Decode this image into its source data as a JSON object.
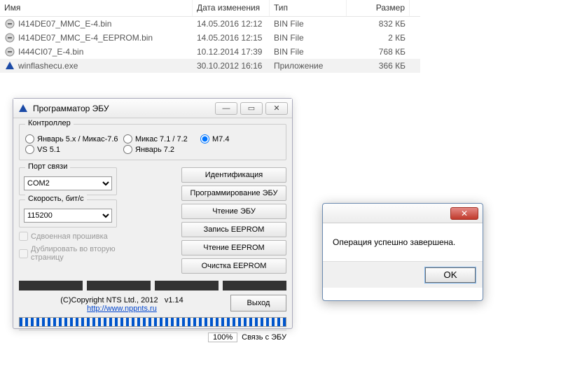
{
  "filelist": {
    "headers": {
      "name": "Имя",
      "date": "Дата изменения",
      "type": "Тип",
      "size": "Размер"
    },
    "rows": [
      {
        "icon": "binfile",
        "name": "I414DE07_MMC_E-4.bin",
        "date": "14.05.2016 12:12",
        "type": "BIN File",
        "size": "832 КБ",
        "selected": false
      },
      {
        "icon": "binfile",
        "name": "I414DE07_MMC_E-4_EEPROM.bin",
        "date": "14.05.2016 12:15",
        "type": "BIN File",
        "size": "2 КБ",
        "selected": false
      },
      {
        "icon": "binfile",
        "name": "I444CI07_E-4.bin",
        "date": "10.12.2014 17:39",
        "type": "BIN File",
        "size": "768 КБ",
        "selected": false
      },
      {
        "icon": "app",
        "name": "winflashecu.exe",
        "date": "30.10.2012 16:16",
        "type": "Приложение",
        "size": "366 КБ",
        "selected": true
      }
    ]
  },
  "app": {
    "title": "Программатор ЭБУ",
    "controller_group": "Контроллер",
    "radios": {
      "r1": "Январь 5.x / Микас-7.6",
      "r2": "Микас 7.1 / 7.2",
      "r3": "М7.4",
      "r4": "VS 5.1",
      "r5": "Январь 7.2"
    },
    "selected_radio": "r3",
    "port_label": "Порт связи",
    "port_value": "COM2",
    "speed_label": "Скорость, бит/с",
    "speed_value": "115200",
    "chk_double": "Сдвоенная прошивка",
    "chk_dup": "Дублировать во вторую страницу",
    "btns": {
      "ident": "Идентификация",
      "prog": "Программирование ЭБУ",
      "read": "Чтение ЭБУ",
      "weep": "Запись EEPROM",
      "reep": "Чтение EEPROM",
      "ceep": "Очистка EEPROM"
    },
    "copyright": "(C)Copyright NTS Ltd., 2012",
    "version": "v1.14",
    "url": "http://www.nppnts.ru",
    "exit": "Выход",
    "status_pct": "100%",
    "status_text": "Связь с ЭБУ"
  },
  "msg": {
    "text": "Операция успешно завершена.",
    "ok": "OK"
  }
}
